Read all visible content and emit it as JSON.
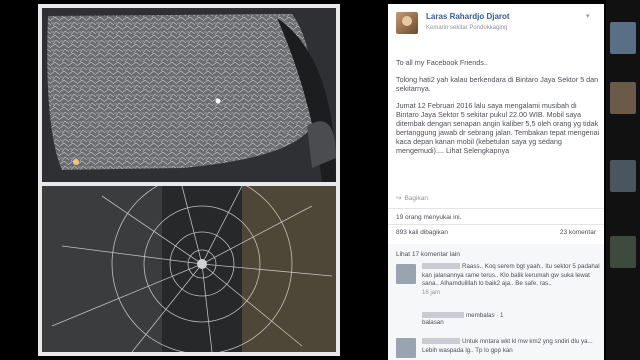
{
  "post": {
    "author": "Laras Rahardjo Djarot",
    "location": "Kemarin sekitar Pondokkaging",
    "greeting": "To all my Facebook Friends..",
    "paragraph1": "Tolong hati2 yah kalau berkendara di Bintaro Jaya Sektor 5 dan sekitarnya.",
    "paragraph2": "Jumat 12 Februari 2016 lalu saya mengalami musibah di Bintaro Jaya Sektor 5 sekitar pukul 22.00 WIB. Mobil saya ditembak dengan senapan angin kaliber 5,5 oleh orang yg tidak bertanggung jawab dr sebrang jalan. Tembakan tepat mengenai kaca depan kanan mobil (kebetulan saya yg sedang mengemudi)....",
    "see_more": "Lihat Selengkapnya",
    "share_label": "Bagikan",
    "likes": "19 orang menyukai ini.",
    "shares": "893 kali dibagikan",
    "comments_count": "23 komentar",
    "prev_comments": "Lihat 17 komentar lain"
  },
  "comments": [
    {
      "text": "Raass.. Koq serem bgt yaah.. Itu sektor 5 padahal kan jalanannya rame terus.. Klo balik kerumah gw suka lewat sana.. Alhamdulillah lo baik2 aja.. Be safe, ras..",
      "time": "16 jam",
      "replies_prefix": "membalas · 1",
      "replies_suffix": "balasan"
    },
    {
      "text": "Untuk mntara wkt kl mw km2 yng sndiri dlu ya... Lebih waspada lg.. Tp lo gpp kan"
    }
  ]
}
